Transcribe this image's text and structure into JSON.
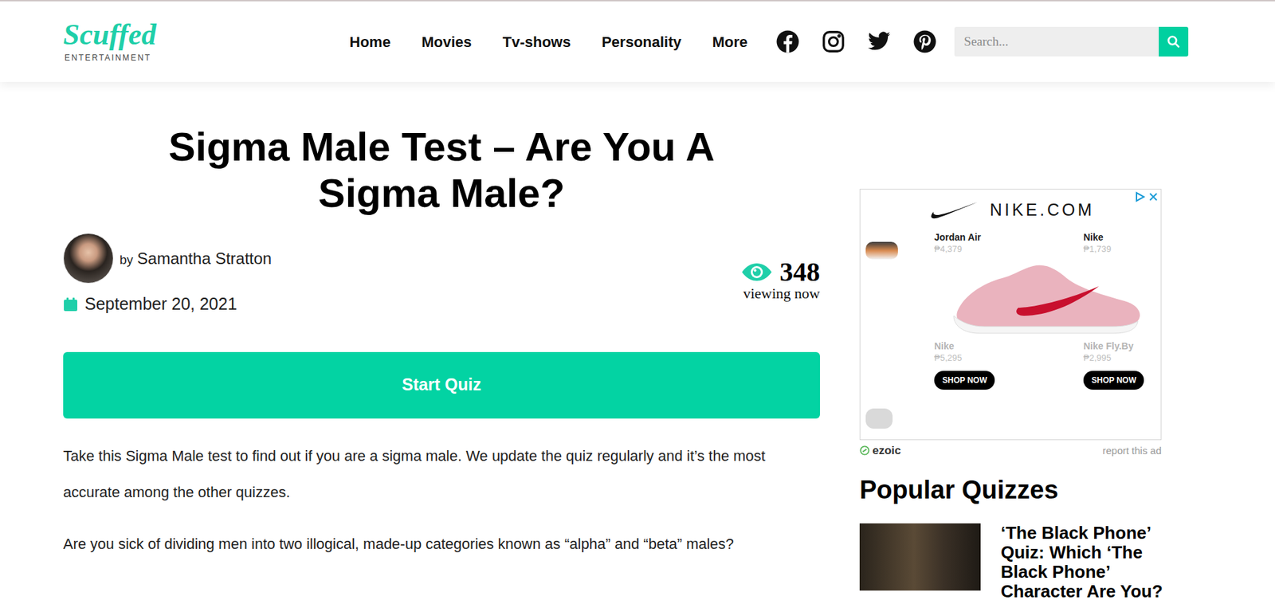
{
  "logo": {
    "script": "Scuffed",
    "subtitle": "ENTERTAINMENT"
  },
  "nav": [
    "Home",
    "Movies",
    "Tv-shows",
    "Personality",
    "More"
  ],
  "search": {
    "placeholder": "Search..."
  },
  "article": {
    "title": "Sigma Male Test – Are You A Sigma Male?",
    "author": {
      "prefix": "by",
      "name": "Samantha Stratton"
    },
    "date": "September 20, 2021",
    "views": {
      "count": "348",
      "label": "viewing now"
    },
    "start_button": "Start Quiz",
    "paragraphs": [
      "Take this Sigma Male test to find out if you are a sigma male. We update the quiz regularly and it’s the most accurate among the other quizzes.",
      "Are you sick of dividing men into two illogical, made-up categories known as “alpha” and “beta” males?"
    ]
  },
  "ad": {
    "brand": "NIKE.COM",
    "products": [
      {
        "name": "Jordan Air",
        "price": "₱4,379",
        "faded": false
      },
      {
        "name": "Nike",
        "price": "₱1,739",
        "faded": false
      },
      {
        "name": "Nike",
        "price": "₱5,295",
        "faded": true
      },
      {
        "name": "Nike Fly.By",
        "price": "₱2,995",
        "faded": true
      }
    ],
    "buttons": [
      "SHOP NOW",
      "SHOP NOW"
    ],
    "network": "ezoic",
    "report": "report this ad"
  },
  "sidebar": {
    "heading": "Popular Quizzes",
    "quizzes": [
      {
        "title": "‘The Black Phone’ Quiz: Which ‘The Black Phone’ Character Are You?"
      }
    ]
  }
}
